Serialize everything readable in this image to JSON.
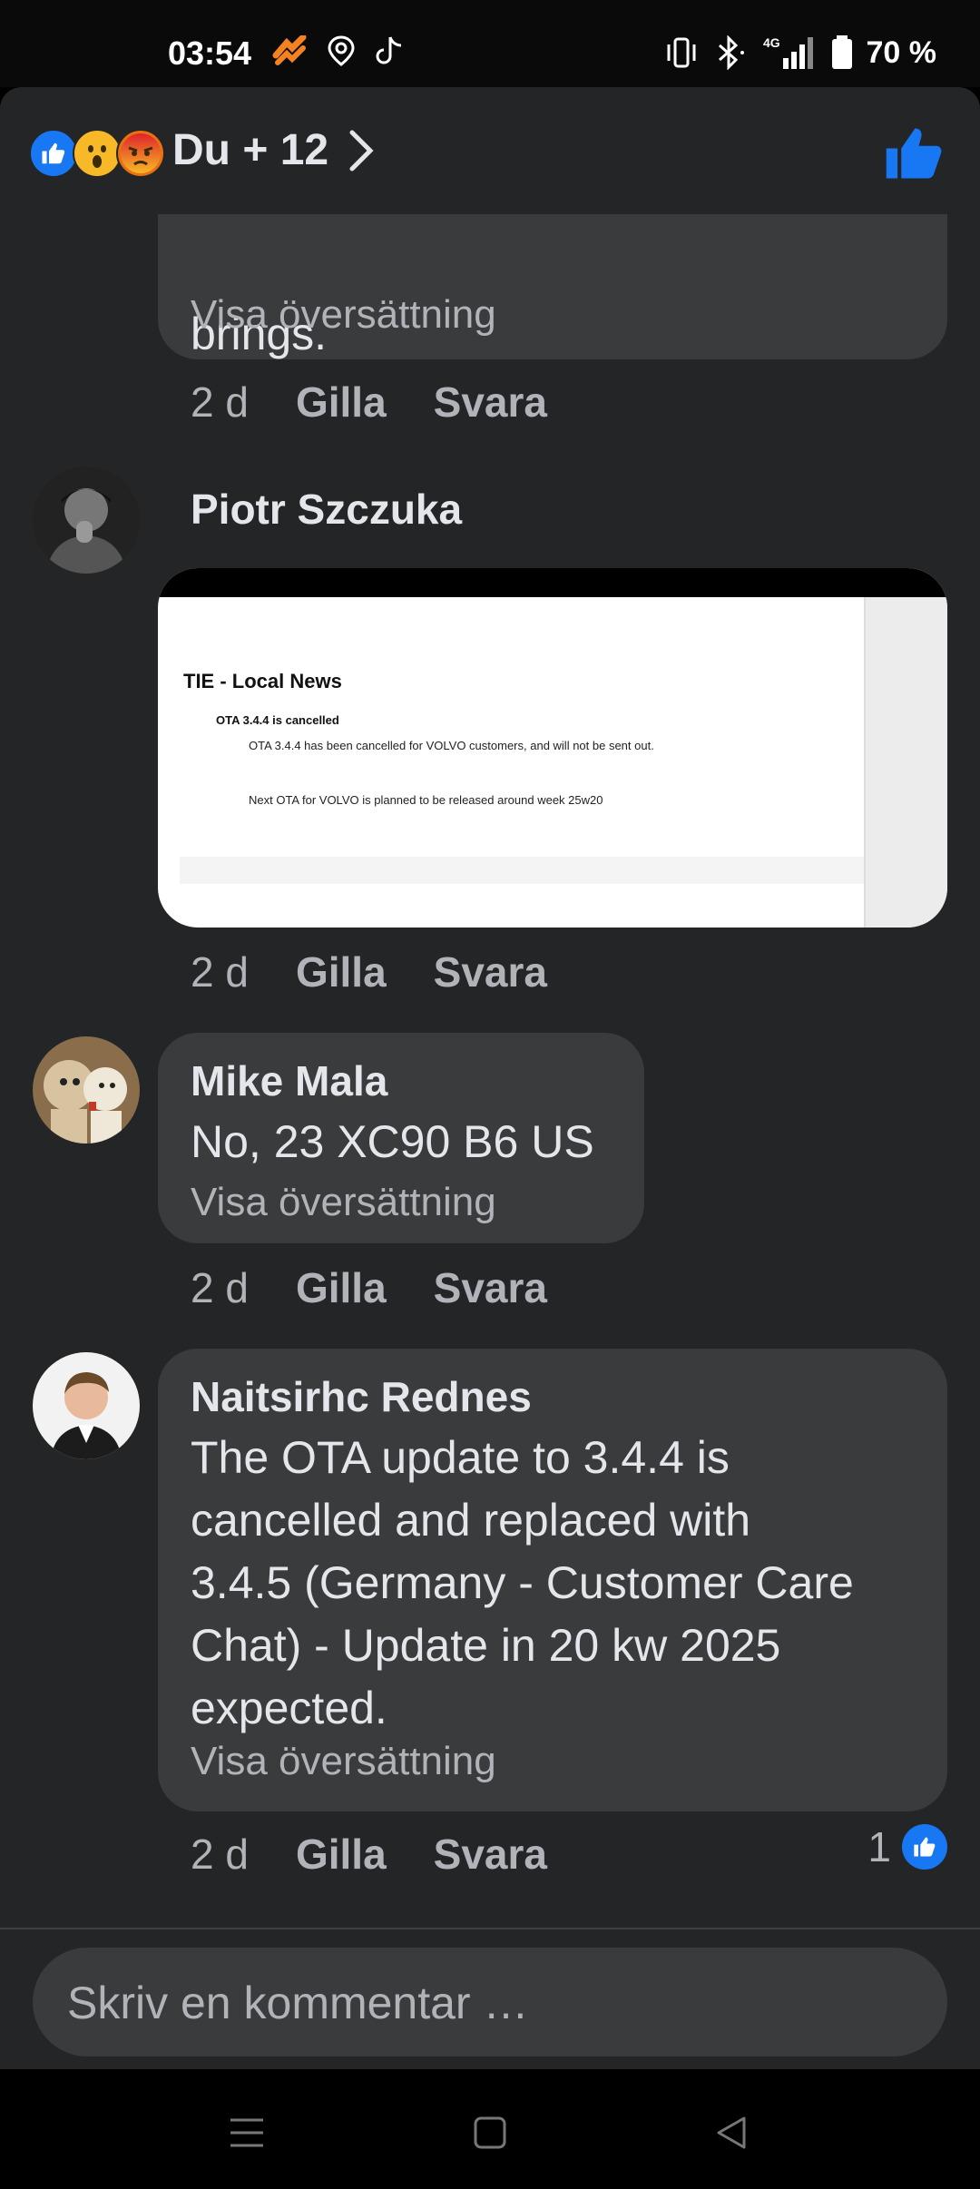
{
  "status_bar": {
    "time": "03:54",
    "battery": "70 %",
    "network": "4G"
  },
  "reactions": {
    "summary": "Du + 12",
    "types": [
      "like-icon",
      "wow-icon",
      "angry-icon"
    ]
  },
  "comments": [
    {
      "text": "brings.",
      "translate": "Visa översättning",
      "time": "2 d",
      "like": "Gilla",
      "reply": "Svara"
    },
    {
      "name": "Piotr Szczuka",
      "time": "2 d",
      "like": "Gilla",
      "reply": "Svara",
      "attachment": {
        "title": "TIE - Local News",
        "heading": "OTA 3.4.4 is cancelled",
        "line1": "OTA 3.4.4 has been cancelled for VOLVO customers, and will not be sent out.",
        "line2": "Next OTA for VOLVO is planned to be released around week 25w20"
      }
    },
    {
      "name": "Mike Mala",
      "text": "No, 23 XC90 B6 US",
      "translate": "Visa översättning",
      "time": "2 d",
      "like": "Gilla",
      "reply": "Svara"
    },
    {
      "name": "Naitsirhc Rednes",
      "text_lines": [
        "The OTA update to 3.4.4 is",
        "cancelled and replaced with",
        "3.4.5 (Germany - Customer Care",
        "Chat) - Update in 20 kw 2025",
        "expected."
      ],
      "translate": "Visa översättning",
      "time": "2 d",
      "like": "Gilla",
      "reply": "Svara",
      "like_count": "1"
    }
  ],
  "composer": {
    "placeholder": "Skriv en kommentar …"
  },
  "colors": {
    "accent": "#1877f2",
    "bubble": "#3a3b3c",
    "sheet": "#242526"
  }
}
